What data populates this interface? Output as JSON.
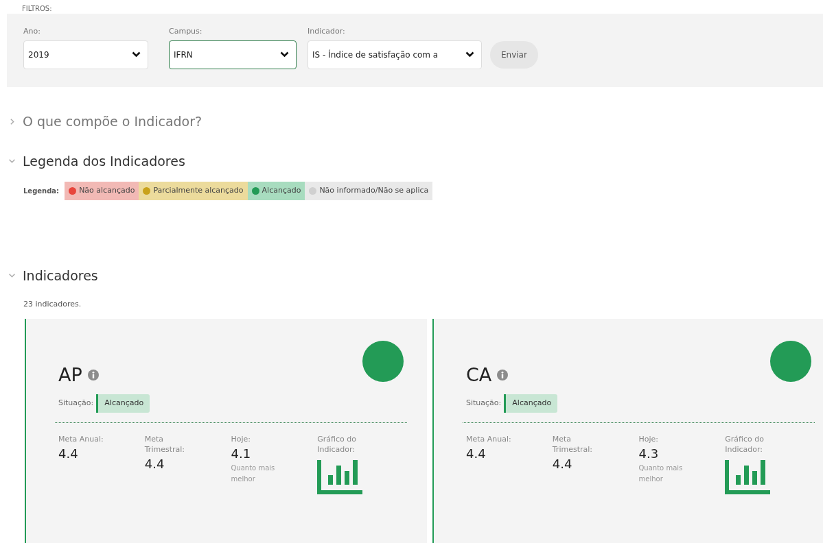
{
  "filters": {
    "legend": "FILTROS:",
    "fields": [
      {
        "label": "Ano:",
        "value": "2019",
        "focused": false
      },
      {
        "label": "Campus:",
        "value": "IFRN",
        "focused": true
      },
      {
        "label": "Indicador:",
        "value": "IS - Índice de satisfação com a",
        "focused": false
      }
    ],
    "submit": "Enviar"
  },
  "sections": [
    {
      "title": "O que compõe o Indicador?",
      "expanded": false
    },
    {
      "title": "Legenda dos Indicadores",
      "expanded": true
    }
  ],
  "legend": {
    "label": "Legenda:",
    "items": [
      {
        "text": "Não alcançado",
        "color": "#e8453c"
      },
      {
        "text": "Parcialmente alcançado",
        "color": "#c9a21b"
      },
      {
        "text": "Alcançado",
        "color": "#239b56"
      },
      {
        "text": "Não informado/Não se aplica",
        "color": "#d0d0d0"
      }
    ]
  },
  "indicators": {
    "title": "Indicadores",
    "expanded": true,
    "count": "23 indicadores.",
    "cards": [
      {
        "code": "AP",
        "color": "#239b56",
        "situation_label": "Situação:",
        "situation": "Alcançado",
        "annual_label": "Meta Anual:",
        "annual": "4.4",
        "quarterly_label": "Meta Trimestral:",
        "quarterly": "4.4",
        "today_label": "Hoje:",
        "today": "4.1",
        "hint": "Quanto mais melhor",
        "chart_label": "Gráfico do Indicador:"
      },
      {
        "code": "CA",
        "color": "#239b56",
        "situation_label": "Situação:",
        "situation": "Alcançado",
        "annual_label": "Meta Anual:",
        "annual": "4.4",
        "quarterly_label": "Meta Trimestral:",
        "quarterly": "4.4",
        "today_label": "Hoje:",
        "today": "4.3",
        "hint": "Quanto mais melhor",
        "chart_label": "Gráfico do Indicador:"
      }
    ]
  }
}
